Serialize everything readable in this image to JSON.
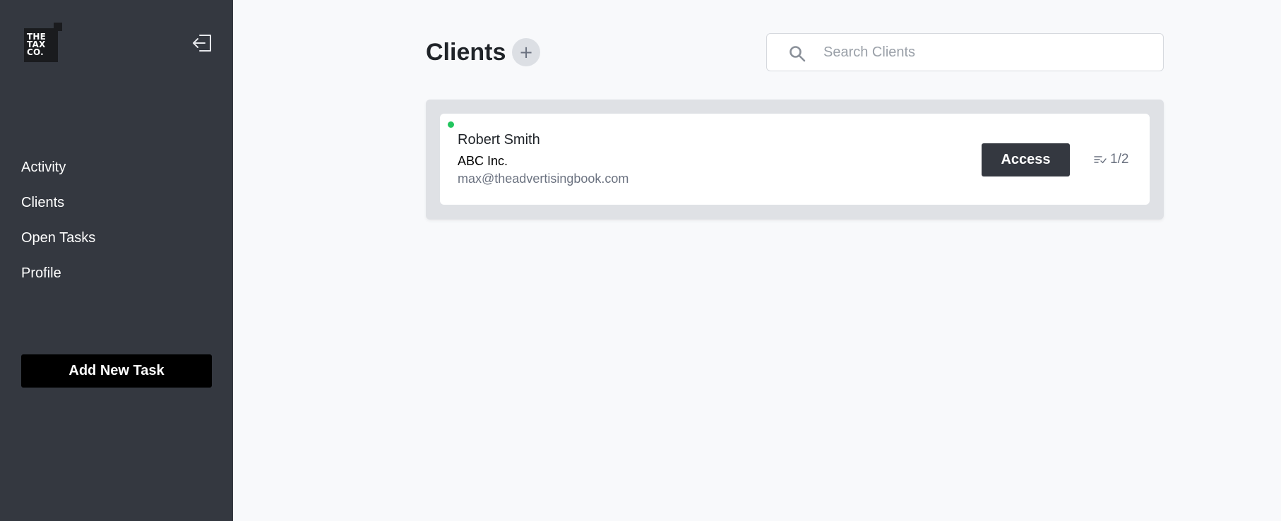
{
  "sidebar": {
    "logo_text": "THE TAX CO.",
    "logo_lines": [
      "THE",
      "TAX",
      "CO."
    ],
    "logout_icon": "logout-icon",
    "nav_items": [
      {
        "label": "Activity"
      },
      {
        "label": "Clients"
      },
      {
        "label": "Open Tasks"
      },
      {
        "label": "Profile"
      }
    ],
    "add_task_label": "Add New Task"
  },
  "header": {
    "title": "Clients",
    "add_icon": "plus-icon",
    "add_label": "+",
    "search": {
      "icon": "search-icon",
      "placeholder": "Search Clients",
      "value": ""
    }
  },
  "clients": [
    {
      "status": "active",
      "status_color": "#22c55e",
      "name": "Robert Smith",
      "company": "ABC Inc.",
      "email": "max@theadvertisingbook.com",
      "access_label": "Access",
      "tasks_icon": "tasks-check-icon",
      "tasks": "1/2"
    }
  ],
  "colors": {
    "sidebar_bg": "#343840",
    "page_bg": "#f8f9fb",
    "primary_button": "#000000",
    "access_button": "#343840",
    "status_active": "#22c55e"
  }
}
